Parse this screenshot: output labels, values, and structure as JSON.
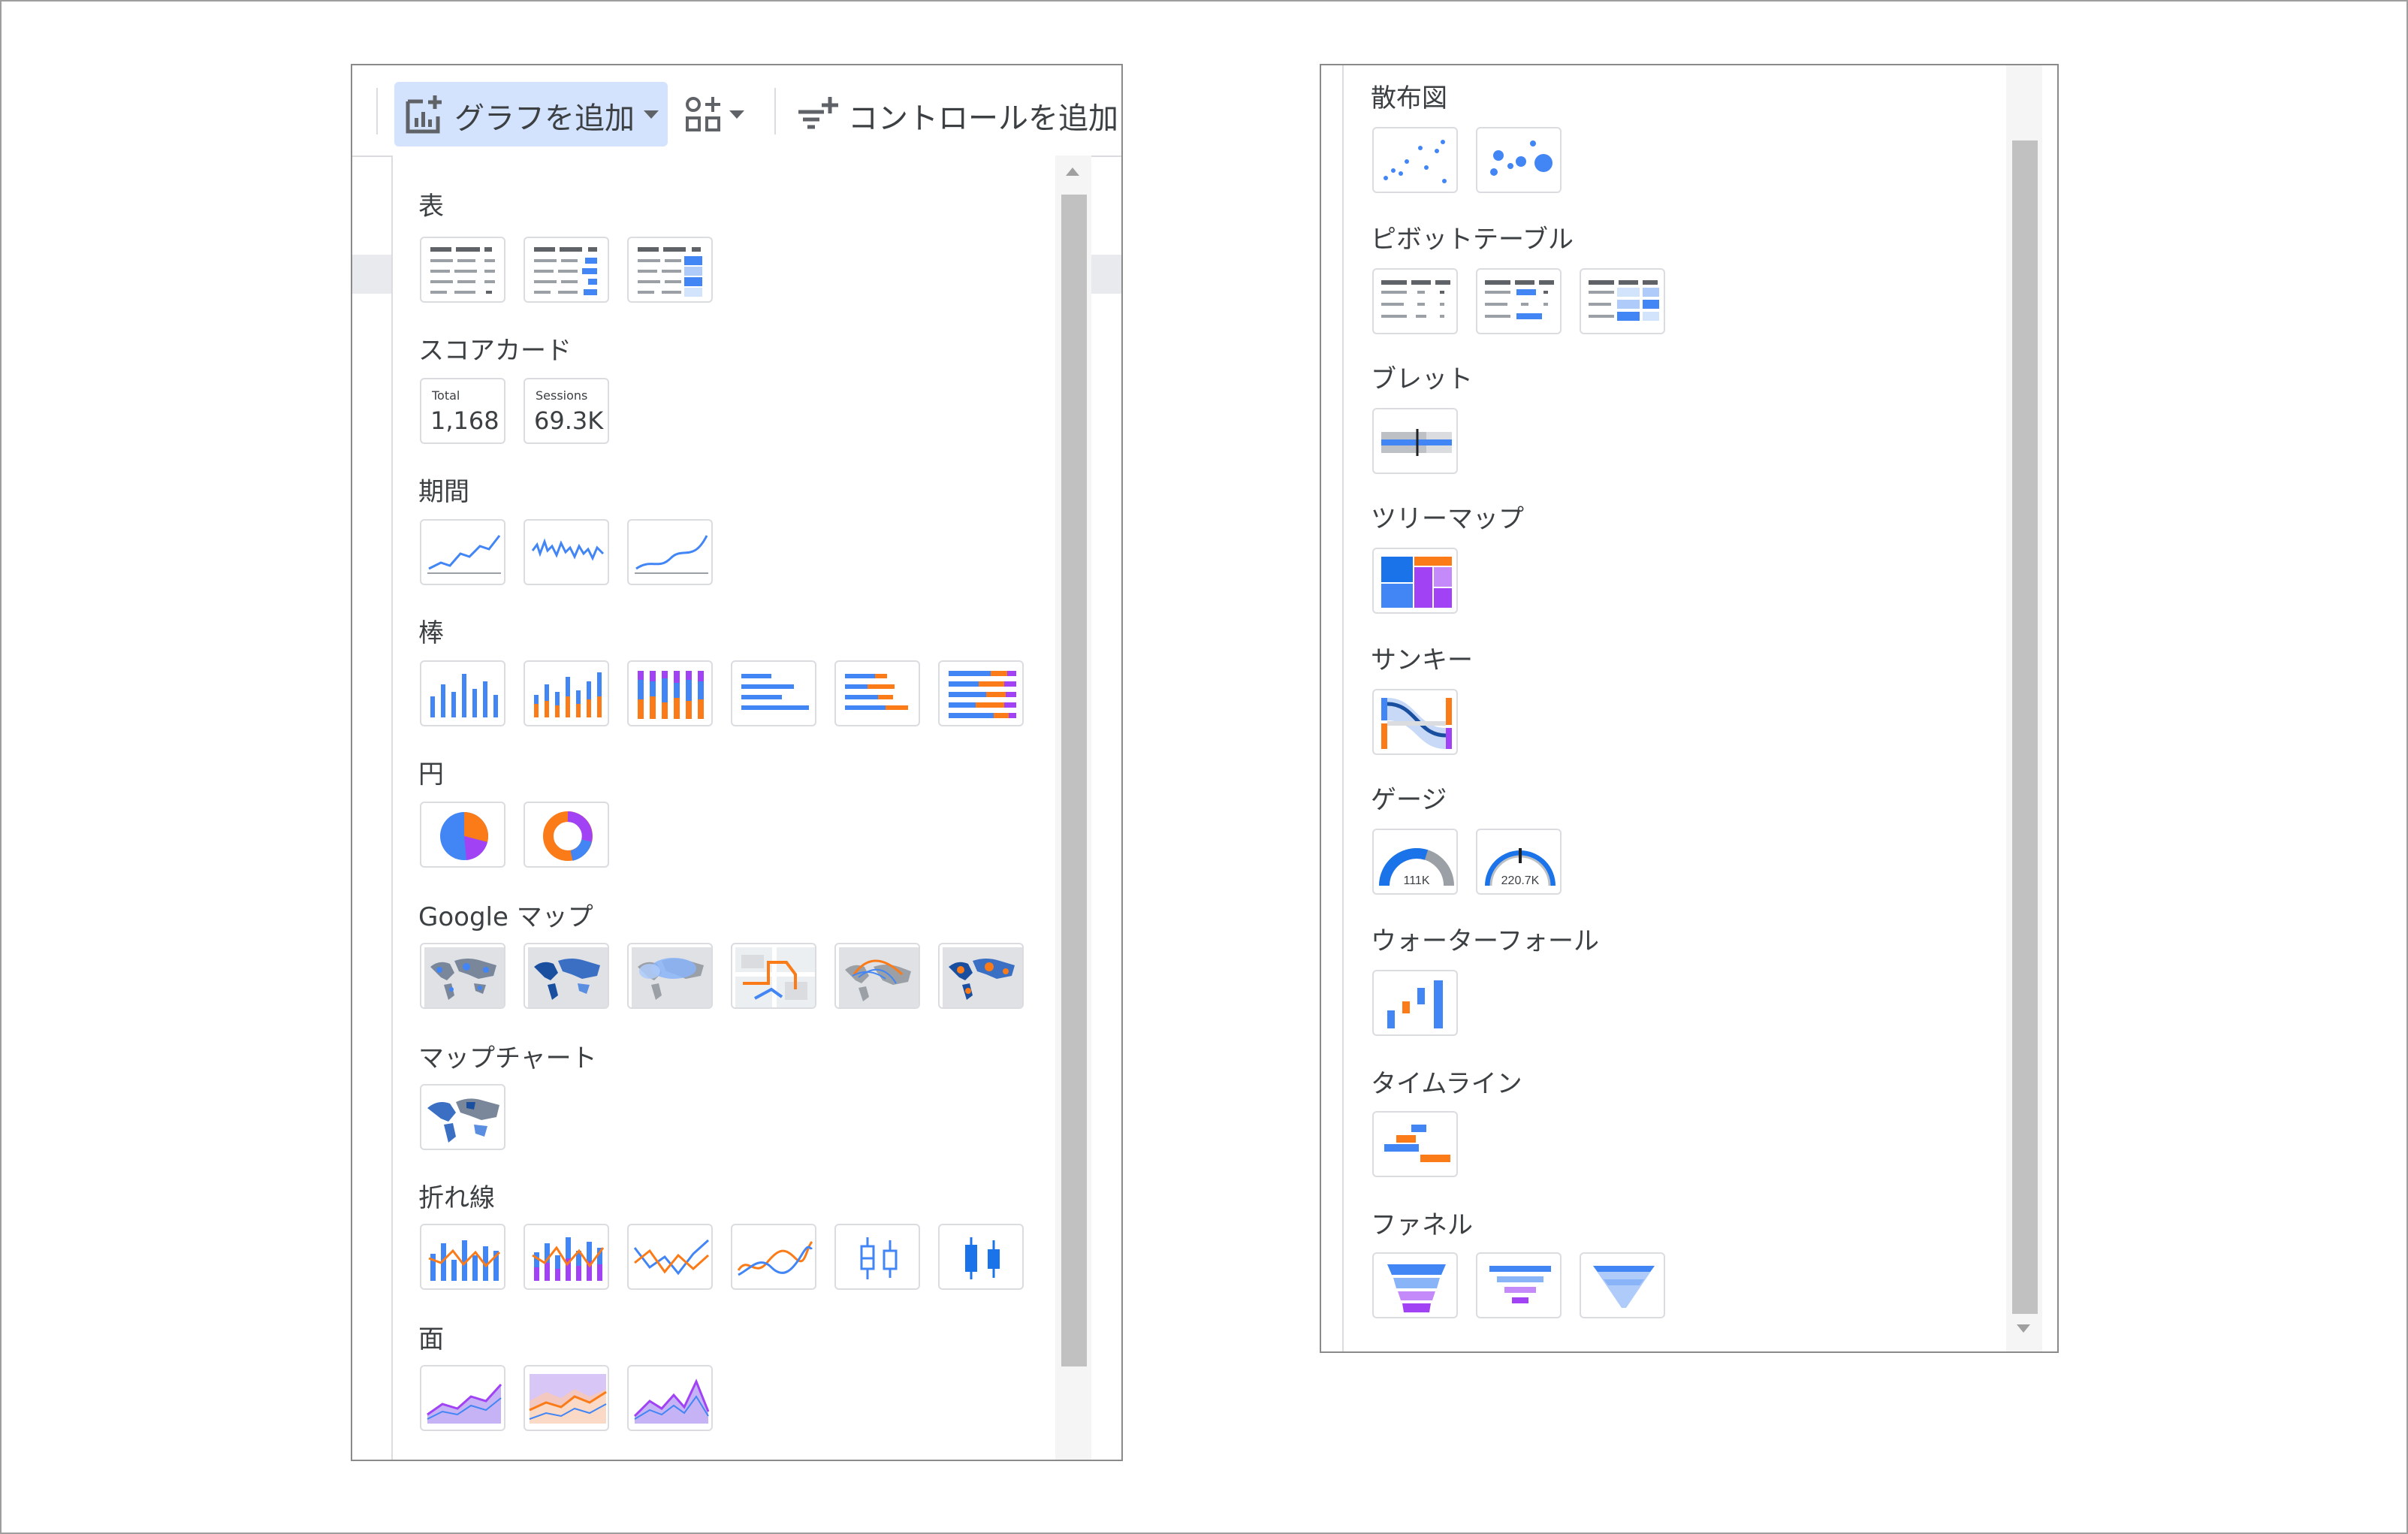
{
  "toolbar": {
    "add_chart_label": "グラフを追加",
    "add_control_label": "コントロールを追加"
  },
  "colors": {
    "blue": "#4285f4",
    "orange": "#fa7b17",
    "purple": "#a142f4",
    "gray": "#9aa0a6",
    "dark": "#5f6368"
  },
  "left_sections": {
    "table": "表",
    "scorecard": "スコアカード",
    "period": "期間",
    "bar": "棒",
    "pie": "円",
    "google_maps": "Google マップ",
    "map_chart": "マップチャート",
    "line": "折れ線",
    "area": "面"
  },
  "scorecards": [
    {
      "label": "Total",
      "value": "1,168"
    },
    {
      "label": "Sessions",
      "value": "69.3K"
    }
  ],
  "right_sections": {
    "scatter": "散布図",
    "pivot": "ピボットテーブル",
    "bullet": "ブレット",
    "treemap": "ツリーマップ",
    "sankey": "サンキー",
    "gauge": "ゲージ",
    "waterfall": "ウォーターフォール",
    "timeline": "タイムライン",
    "funnel": "ファネル"
  },
  "gauges": [
    {
      "value": "111K"
    },
    {
      "value": "220.7K"
    }
  ]
}
